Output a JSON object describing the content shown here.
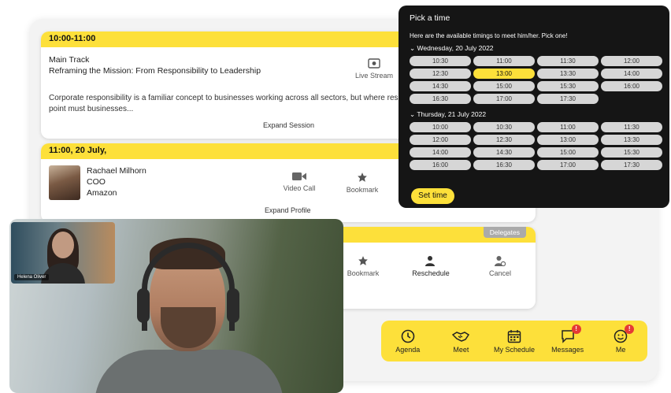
{
  "session": {
    "time": "10:00-11:00",
    "track": "Main Track",
    "title": "Reframing the Mission: From Responsibility to Leadership",
    "live_label": "Live Stream",
    "description": "Corporate responsibility is a familiar concept to businesses working across all sectors, but where responsibility and leadership? At what point must businesses...",
    "expand_label": "Expand Session"
  },
  "profile": {
    "time": "11:00, 20 July,",
    "name": "Rachael Milhorn",
    "role": "COO",
    "company": "Amazon",
    "video_call_label": "Video Call",
    "bookmark_label": "Bookmark",
    "expand_label": "Expand Profile"
  },
  "delegate": {
    "badge": "Delegates",
    "bookmark_label": "Bookmark",
    "reschedule_label": "Reschedule",
    "cancel_label": "Cancel"
  },
  "nav": {
    "agenda": "Agenda",
    "meet": "Meet",
    "schedule": "My Schedule",
    "messages": "Messages",
    "me": "Me",
    "messages_badge": "!",
    "me_badge": "!"
  },
  "video": {
    "pip_name": "Helena Oliver"
  },
  "picker": {
    "title": "Pick a time",
    "subtitle": "Here are the available timings to meet him/her. Pick one!",
    "day1": "Wednesday, 20 July 2022",
    "day1_slots": [
      "10:30",
      "11:00",
      "11:30",
      "12:00",
      "12:30",
      "13:00",
      "13:30",
      "14:00",
      "14:30",
      "15:00",
      "15:30",
      "16:00",
      "16:30",
      "17:00",
      "17:30"
    ],
    "day1_selected": "13:00",
    "day2": "Thursday, 21 July 2022",
    "day2_slots": [
      "10:00",
      "10:30",
      "11:00",
      "11:30",
      "12:00",
      "12:30",
      "13:00",
      "13:30",
      "14:00",
      "14:30",
      "15:00",
      "15:30",
      "16:00",
      "16:30",
      "17:00",
      "17:30"
    ],
    "set_label": "Set time"
  },
  "colors": {
    "accent": "#fde03a",
    "picker_bg": "#151515",
    "badge_red": "#e53935"
  }
}
